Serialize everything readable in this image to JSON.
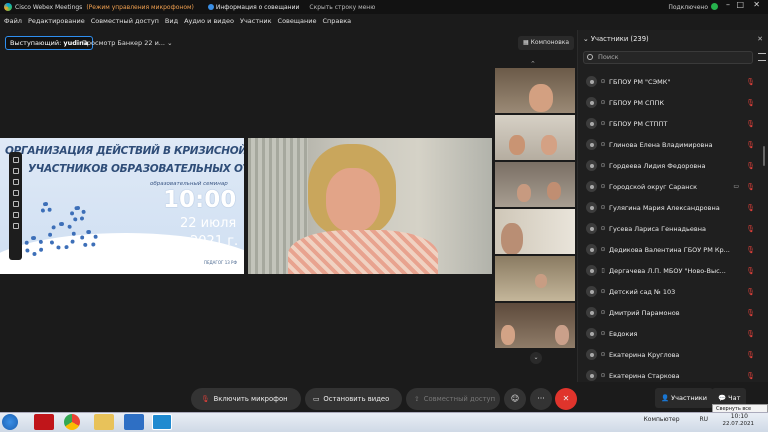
{
  "window": {
    "app_title": "Cisco Webex Meetings",
    "mode": "(Режим управления микрофоном)",
    "meeting_info": "Информация о совещании",
    "hide_menu": "Скрыть строку меню",
    "status": "Подключено",
    "status_color": "#26b14c"
  },
  "menu": [
    "Файл",
    "Редактирование",
    "Совместный доступ",
    "Вид",
    "Аудио и видео",
    "Участник",
    "Совещание",
    "Справка"
  ],
  "presenter": {
    "label": "Выступающий:",
    "name": "yudina",
    "view": "Просмотр Банкер 22 и..."
  },
  "layout_button": "Компоновка",
  "slide": {
    "line1": "ОРГАНИЗАЦИЯ ДЕЙСТВИЙ В КРИЗИСНОЙ СИТУАЦИИ",
    "line2": "УЧАСТНИКОВ ОБРАЗОВАТЕЛЬНЫХ ОТНОШЕНИЙ",
    "subtitle": "образовательный семинар",
    "time": "10:00",
    "date": "22 июля",
    "year": "2021 г.",
    "footer": "ПЕДАГОГ 13 РФ"
  },
  "participants_panel": {
    "title": "Участники (239)",
    "search_placeholder": "Поиск",
    "items": [
      {
        "name": "ГБПОУ РМ \"СЭМК\""
      },
      {
        "name": "ГБПОУ РМ СППК"
      },
      {
        "name": "ГБПОУ РМ СТППТ"
      },
      {
        "name": "Глинова Елена Владимировна"
      },
      {
        "name": "Гордеева Лидия Федоровна"
      },
      {
        "name": "Городской округ Саранск"
      },
      {
        "name": "Гулягина Мария Александровна"
      },
      {
        "name": "Гусева Лариса Геннадьевна"
      },
      {
        "name": "Дедикова Валентина ГБОУ РМ Кр..."
      },
      {
        "name": "Дергачева Л.П. МБОУ \"Ново-Выс..."
      },
      {
        "name": "Детский сад № 103"
      },
      {
        "name": "Дмитрий Парамонов"
      },
      {
        "name": "Евдокия"
      },
      {
        "name": "Екатерина Круглова"
      },
      {
        "name": "Екатерина Старкова"
      }
    ]
  },
  "controls": {
    "mic": "Включить микрофон",
    "video": "Остановить видео",
    "share": "Совместный доступ",
    "participants": "Участники",
    "chat": "Чат",
    "tooltip": "Свернуть все окна"
  },
  "taskbar": {
    "tray_label": "Компьютер",
    "lang": "RU",
    "time": "10:10",
    "date": "22.07.2021"
  }
}
